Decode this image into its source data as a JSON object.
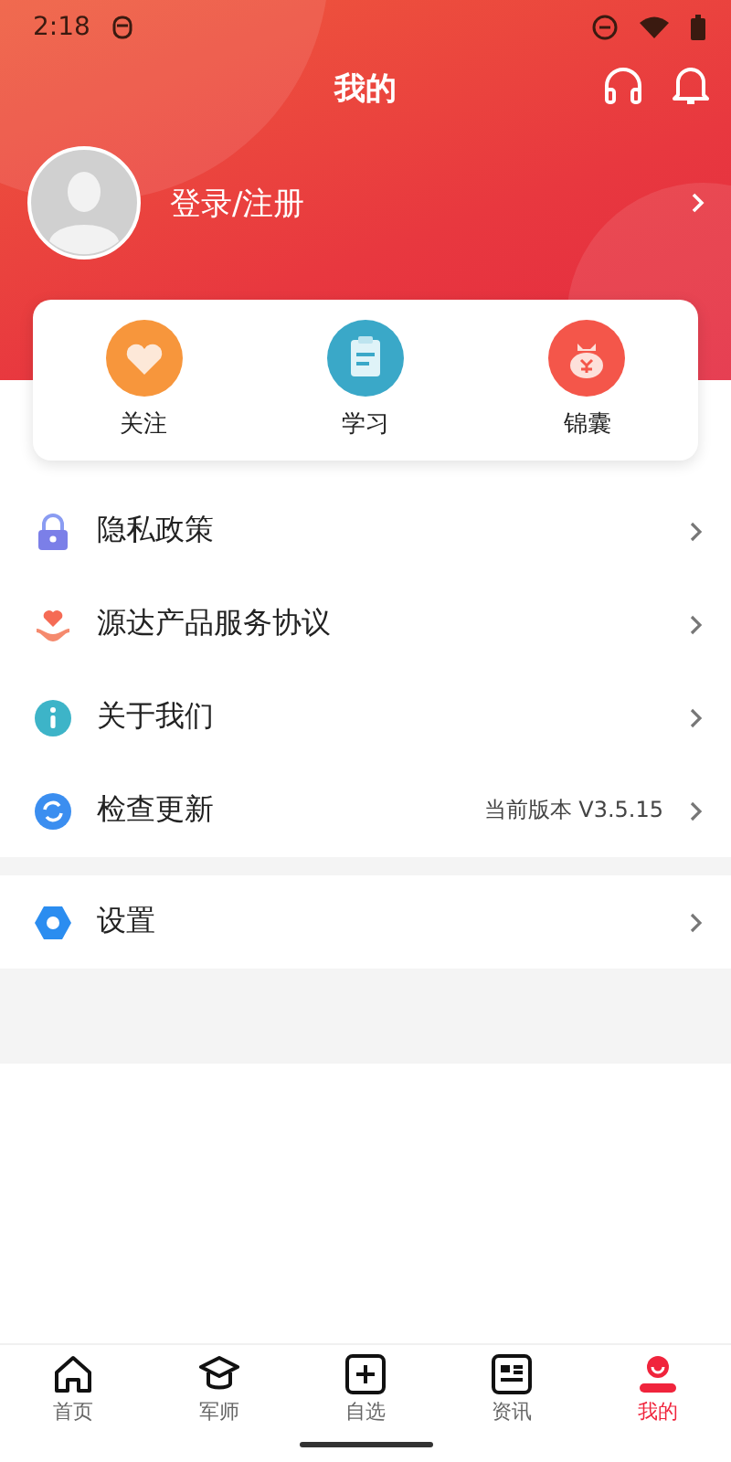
{
  "status_bar": {
    "time": "2:18"
  },
  "header": {
    "title": "我的"
  },
  "profile": {
    "login": "登录/注册"
  },
  "shortcuts": [
    {
      "label": "关注"
    },
    {
      "label": "学习"
    },
    {
      "label": "锦囊"
    }
  ],
  "sections": [
    [
      {
        "label": "隐私政策"
      },
      {
        "label": "源达产品服务协议"
      },
      {
        "label": "关于我们"
      },
      {
        "label": "检查更新",
        "value": "当前版本 V3.5.15"
      }
    ],
    [
      {
        "label": "设置"
      }
    ]
  ],
  "nav": [
    {
      "label": "首页",
      "selected": false
    },
    {
      "label": "军师",
      "selected": false
    },
    {
      "label": "自选",
      "selected": false
    },
    {
      "label": "资讯",
      "selected": false
    },
    {
      "label": "我的",
      "selected": true
    }
  ]
}
